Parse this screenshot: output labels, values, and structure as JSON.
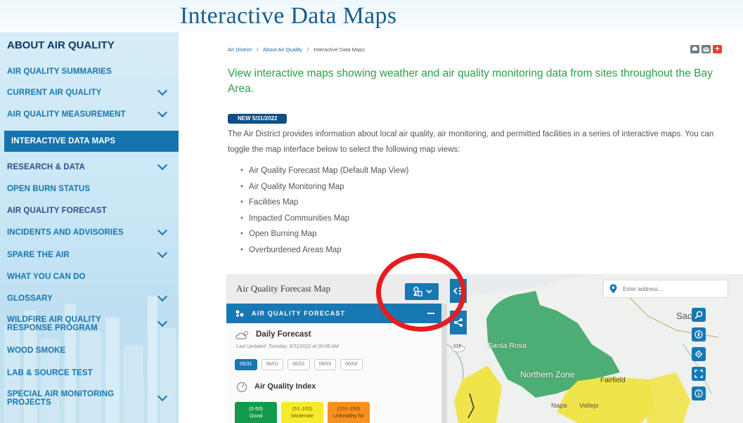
{
  "header": {
    "title": "Interactive Data Maps"
  },
  "sidebar": {
    "heading": "ABOUT AIR QUALITY",
    "items": [
      {
        "label": "AIR QUALITY SUMMARIES",
        "has_chevron": false
      },
      {
        "label": "CURRENT AIR QUALITY",
        "has_chevron": true
      },
      {
        "label": "AIR QUALITY MEASUREMENT",
        "has_chevron": true
      },
      {
        "label": "INTERACTIVE DATA MAPS",
        "has_chevron": false,
        "active": true
      },
      {
        "label": "RESEARCH & DATA",
        "has_chevron": true
      },
      {
        "label": "OPEN BURN STATUS",
        "has_chevron": false
      },
      {
        "label": "AIR QUALITY FORECAST",
        "has_chevron": false
      },
      {
        "label": "INCIDENTS AND ADVISORIES",
        "has_chevron": true
      },
      {
        "label": "SPARE THE AIR",
        "has_chevron": true
      },
      {
        "label": "WHAT YOU CAN DO",
        "has_chevron": false
      },
      {
        "label": "GLOSSARY",
        "has_chevron": true
      },
      {
        "label": "WILDFIRE AIR QUALITY RESPONSE PROGRAM",
        "has_chevron": true
      },
      {
        "label": "WOOD SMOKE",
        "has_chevron": false
      },
      {
        "label": "LAB & SOURCE TEST",
        "has_chevron": false
      },
      {
        "label": "SPECIAL AIR MONITORING PROJECTS",
        "has_chevron": true
      }
    ]
  },
  "breadcrumb": {
    "items": [
      "Air District",
      "About Air Quality",
      "Interactive Data Maps"
    ],
    "separator": "/"
  },
  "main": {
    "intro": "View interactive maps showing weather and air quality monitoring data from sites throughout the Bay Area.",
    "badge": "NEW 5/31/2022",
    "description": "The Air District provides information about local air quality, air monitoring, and permitted facilities in a series of interactive maps.  You can toggle the map interface below to select the following map views:",
    "map_views": [
      "Air Quality Forecast Map (Default Map View)",
      "Air Quality Monitoring Map",
      "Facilities Map",
      "Impacted Communities Map",
      "Open Burning Map",
      "Overburdened Areas Map"
    ]
  },
  "map": {
    "title": "Air Quality Forecast Map",
    "panel_header": "AIR QUALITY FORECAST",
    "daily_forecast_title": "Daily Forecast",
    "last_updated": "Last Updated: Tuesday, 5/31/2022 at 09:08 AM",
    "dates": [
      "05/31",
      "06/01",
      "06/02",
      "06/03",
      "06/04"
    ],
    "selected_date": "05/31",
    "aqi_title": "Air Quality Index",
    "aqi_tiles": [
      {
        "range": "(0-50)",
        "label": "Good"
      },
      {
        "range": "(51-100)",
        "label": "Moderate"
      },
      {
        "range": "(101-150)",
        "label": "Unhealthy for"
      }
    ],
    "address_placeholder": "Enter address...",
    "labels": {
      "santa_rosa": "Santa Rosa",
      "northern_zone": "Northern Zone",
      "fairfield": "Fairfield",
      "napa": "Napa",
      "vallejo": "Vallejo",
      "sacramento_partial": "Sac",
      "road_number": "116"
    }
  },
  "colors": {
    "brand_blue": "#1778b3",
    "active_nav": "#1474ad",
    "intro_green": "#2aa04a",
    "badge_navy": "#0f4f86",
    "annotation_red": "#e51d20",
    "aqi_good": "#119a4c",
    "aqi_moderate": "#f6ea2d",
    "aqi_usg": "#f6911f"
  },
  "icons": [
    "print-icon",
    "email-icon",
    "add-icon",
    "layers-icon",
    "chevron-down-icon",
    "collapse-panel-icon",
    "share-icon",
    "location-pin-icon",
    "forecast-icon",
    "weather-icon",
    "aqi-gauge-icon",
    "search-zoom-icon",
    "compass-icon",
    "locate-icon",
    "fullscreen-icon",
    "info-icon"
  ]
}
